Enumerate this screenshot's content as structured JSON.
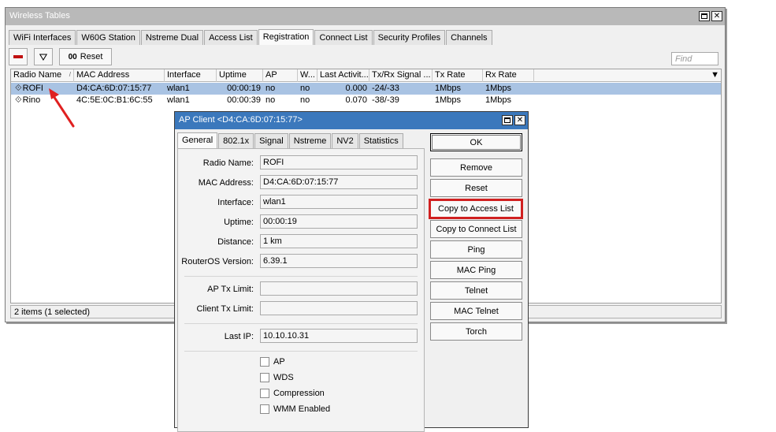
{
  "main_window": {
    "title": "Wireless Tables",
    "tabs": [
      "WiFi Interfaces",
      "W60G Station",
      "Nstreme Dual",
      "Access List",
      "Registration",
      "Connect List",
      "Security Profiles",
      "Channels"
    ],
    "active_tab": "Registration",
    "toolbar": {
      "reset_label": "Reset",
      "reset_prefix": "00",
      "find_placeholder": "Find"
    },
    "table": {
      "columns": [
        "Radio Name",
        "MAC Address",
        "Interface",
        "Uptime",
        "AP",
        "W...",
        "Last Activit...",
        "Tx/Rx Signal ...",
        "Tx Rate",
        "Rx Rate"
      ],
      "sort_indicator": "/",
      "rows": [
        {
          "radio_name": "ROFI",
          "mac": "D4:CA:6D:07:15:77",
          "interface": "wlan1",
          "uptime": "00:00:19",
          "ap": "no",
          "wds": "no",
          "last_activity": "0.000",
          "signal": "-24/-33",
          "tx_rate": "1Mbps",
          "rx_rate": "1Mbps",
          "selected": true
        },
        {
          "radio_name": "Rino",
          "mac": "4C:5E:0C:B1:6C:55",
          "interface": "wlan1",
          "uptime": "00:00:39",
          "ap": "no",
          "wds": "no",
          "last_activity": "0.070",
          "signal": "-38/-39",
          "tx_rate": "1Mbps",
          "rx_rate": "1Mbps",
          "selected": false
        }
      ]
    },
    "status": "2 items (1 selected)"
  },
  "dialog": {
    "title": "AP Client <D4:CA:6D:07:15:77>",
    "tabs": [
      "General",
      "802.1x",
      "Signal",
      "Nstreme",
      "NV2",
      "Statistics"
    ],
    "active_tab": "General",
    "fields": {
      "radio_name": {
        "label": "Radio Name:",
        "value": "ROFI"
      },
      "mac_address": {
        "label": "MAC Address:",
        "value": "D4:CA:6D:07:15:77"
      },
      "interface": {
        "label": "Interface:",
        "value": "wlan1"
      },
      "uptime": {
        "label": "Uptime:",
        "value": "00:00:19"
      },
      "distance": {
        "label": "Distance:",
        "value": "1 km"
      },
      "routeros_version": {
        "label": "RouterOS Version:",
        "value": "6.39.1"
      },
      "ap_tx_limit": {
        "label": "AP Tx Limit:",
        "value": ""
      },
      "client_tx_limit": {
        "label": "Client Tx Limit:",
        "value": ""
      },
      "last_ip": {
        "label": "Last IP:",
        "value": "10.10.10.31"
      }
    },
    "checkboxes": [
      "AP",
      "WDS",
      "Compression",
      "WMM Enabled"
    ],
    "buttons": {
      "ok": "OK",
      "remove": "Remove",
      "reset": "Reset",
      "copy_access": "Copy to Access List",
      "copy_connect": "Copy to Connect List",
      "ping": "Ping",
      "mac_ping": "MAC Ping",
      "telnet": "Telnet",
      "mac_telnet": "MAC Telnet",
      "torch": "Torch"
    }
  },
  "colors": {
    "selected_row": "#a9c3e3",
    "dialog_titlebar": "#3b78bc",
    "inactive_titlebar": "#b9b9b9",
    "highlight_red": "#d02020",
    "remove_icon": "#c01010"
  },
  "icons": [
    "remove-icon",
    "filter-icon",
    "radio-icon",
    "maximize-icon",
    "close-icon",
    "dropdown-arrow-icon"
  ]
}
